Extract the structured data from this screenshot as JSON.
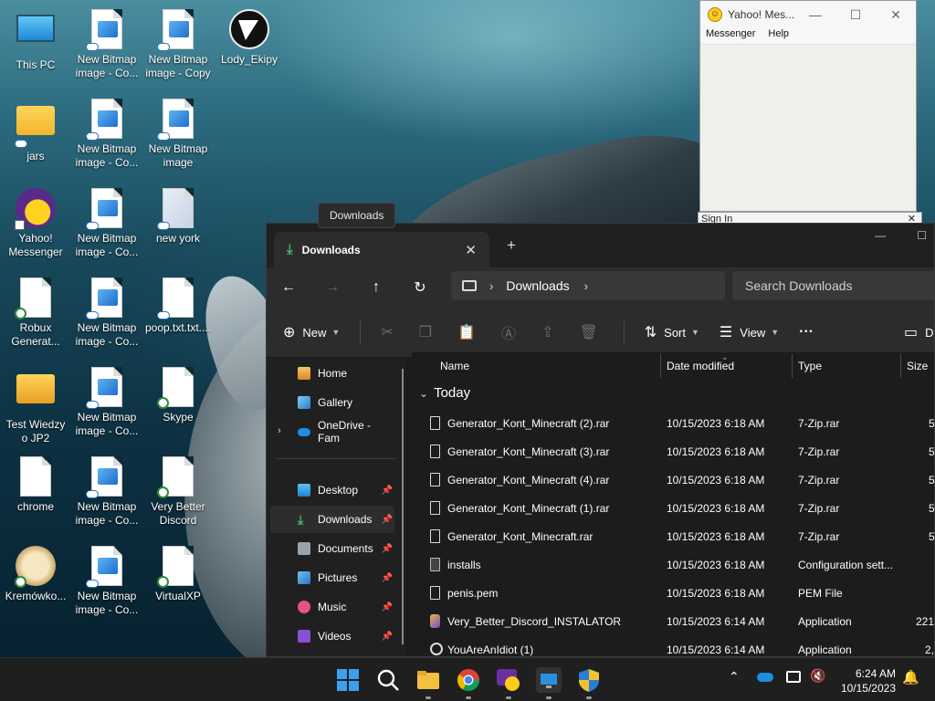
{
  "desktop": {
    "icons": [
      {
        "label": "This PC"
      },
      {
        "label": "New Bitmap image - Co..."
      },
      {
        "label": "New Bitmap image - Copy"
      },
      {
        "label": "Lody_Ekipy"
      },
      {
        "label": "jars"
      },
      {
        "label": "New Bitmap image - Co..."
      },
      {
        "label": "New Bitmap image"
      },
      {
        "label": "Yahoo! Messenger"
      },
      {
        "label": "New Bitmap image - Co..."
      },
      {
        "label": "new york"
      },
      {
        "label": "Robux Generat..."
      },
      {
        "label": "New Bitmap image - Co..."
      },
      {
        "label": "poop.txt.txt...."
      },
      {
        "label": "Test Wiedzy o JP2"
      },
      {
        "label": "New Bitmap image - Co..."
      },
      {
        "label": "Skype"
      },
      {
        "label": "chrome"
      },
      {
        "label": "New Bitmap image - Co..."
      },
      {
        "label": "Very Better Discord"
      },
      {
        "label": "Kremówko..."
      },
      {
        "label": "New Bitmap image - Co..."
      },
      {
        "label": "VirtualXP"
      }
    ]
  },
  "yahoo": {
    "title": "Yahoo! Mes...",
    "menu": [
      "Messenger",
      "Help"
    ],
    "signin_title": "Sign In"
  },
  "tooltip": {
    "text": "Downloads"
  },
  "explorer": {
    "tab_label": "Downloads",
    "address_segment": "Downloads",
    "search_placeholder": "Search Downloads",
    "toolbar": {
      "new": "New",
      "sort": "Sort",
      "view": "View",
      "details": "D"
    },
    "sidebar": [
      {
        "label": "Home"
      },
      {
        "label": "Gallery"
      },
      {
        "label": "OneDrive - Fam"
      },
      {
        "label": "Desktop"
      },
      {
        "label": "Downloads"
      },
      {
        "label": "Documents"
      },
      {
        "label": "Pictures"
      },
      {
        "label": "Music"
      },
      {
        "label": "Videos"
      }
    ],
    "columns": {
      "name": "Name",
      "date": "Date modified",
      "type": "Type",
      "size": "Size"
    },
    "group": "Today",
    "files": [
      {
        "name": "Generator_Kont_Minecraft (2).rar",
        "date": "10/15/2023 6:18 AM",
        "type": "7-Zip.rar",
        "size": "5,"
      },
      {
        "name": "Generator_Kont_Minecraft (3).rar",
        "date": "10/15/2023 6:18 AM",
        "type": "7-Zip.rar",
        "size": "5,"
      },
      {
        "name": "Generator_Kont_Minecraft (4).rar",
        "date": "10/15/2023 6:18 AM",
        "type": "7-Zip.rar",
        "size": "5,"
      },
      {
        "name": "Generator_Kont_Minecraft (1).rar",
        "date": "10/15/2023 6:18 AM",
        "type": "7-Zip.rar",
        "size": "5,"
      },
      {
        "name": "Generator_Kont_Minecraft.rar",
        "date": "10/15/2023 6:18 AM",
        "type": "7-Zip.rar",
        "size": "5,"
      },
      {
        "name": "installs",
        "date": "10/15/2023 6:18 AM",
        "type": "Configuration sett...",
        "size": ""
      },
      {
        "name": "penis.pem",
        "date": "10/15/2023 6:18 AM",
        "type": "PEM File",
        "size": ""
      },
      {
        "name": "Very_Better_Discord_INSTALATOR",
        "date": "10/15/2023 6:14 AM",
        "type": "Application",
        "size": "221,"
      },
      {
        "name": "YouAreAnIdiot (1)",
        "date": "10/15/2023 6:14 AM",
        "type": "Application",
        "size": "2,"
      }
    ]
  },
  "taskbar": {
    "time": "6:24 AM",
    "date": "10/15/2023"
  },
  "colors": {
    "accent_green": "#3fb86b",
    "explorer_bg": "#1c1c1c",
    "yahoo_yellow": "#ffcc1d",
    "win_blue": "#1e8fe0"
  }
}
